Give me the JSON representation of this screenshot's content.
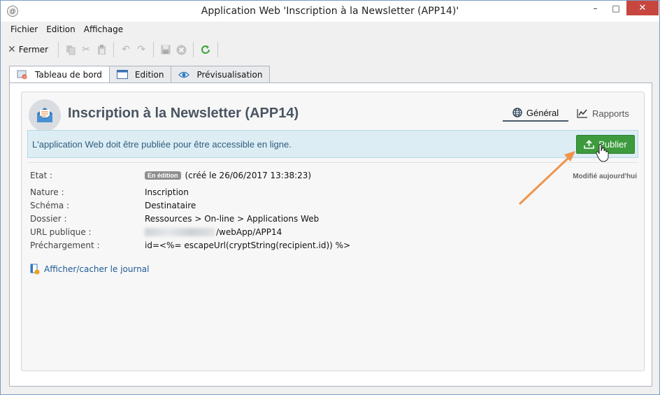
{
  "window": {
    "title": "Application Web 'Inscription à la Newsletter (APP14)'",
    "minimize": "–",
    "maximize": "□",
    "close": "✕"
  },
  "menu": {
    "items": [
      "Fichier",
      "Edition",
      "Affichage"
    ]
  },
  "toolbar": {
    "close_label": "Fermer",
    "icons": [
      "copy-icon",
      "cut-icon",
      "paste-icon",
      "undo-icon",
      "redo-icon",
      "save-icon",
      "cancel-icon",
      "refresh-icon"
    ]
  },
  "tabs": [
    {
      "label": "Tableau de bord",
      "icon": "dashboard-icon",
      "active": true
    },
    {
      "label": "Edition",
      "icon": "edit-window-icon",
      "active": false
    },
    {
      "label": "Prévisualisation",
      "icon": "eye-icon",
      "active": false
    }
  ],
  "page": {
    "title": "Inscription à la Newsletter (APP14)",
    "subtabs": {
      "general": "Général",
      "reports": "Rapports"
    },
    "banner": {
      "text": "L'application Web doit être publiée pour être accessible en ligne.",
      "button": "Publier"
    },
    "modified": "Modifié aujourd'hui",
    "properties": {
      "etat_label": "Etat :",
      "etat_badge": "En édition",
      "etat_value": "(créé le 26/06/2017 13:38:23)",
      "nature_label": "Nature :",
      "nature_value": "Inscription",
      "schema_label": "Schéma :",
      "schema_value": "Destinataire",
      "dossier_label": "Dossier :",
      "dossier_value": "Ressources > On-line > Applications Web",
      "url_label": "URL publique :",
      "url_value": "/webApp/APP14",
      "prech_label": "Préchargement :",
      "prech_value": "id=<%= escapeUrl(cryptString(recipient.id)) %>"
    },
    "log_link": "Afficher/cacher le journal"
  },
  "colors": {
    "publish": "#3d9b3d",
    "banner": "#dcedf4",
    "annotation_arrow": "#f0944a"
  }
}
